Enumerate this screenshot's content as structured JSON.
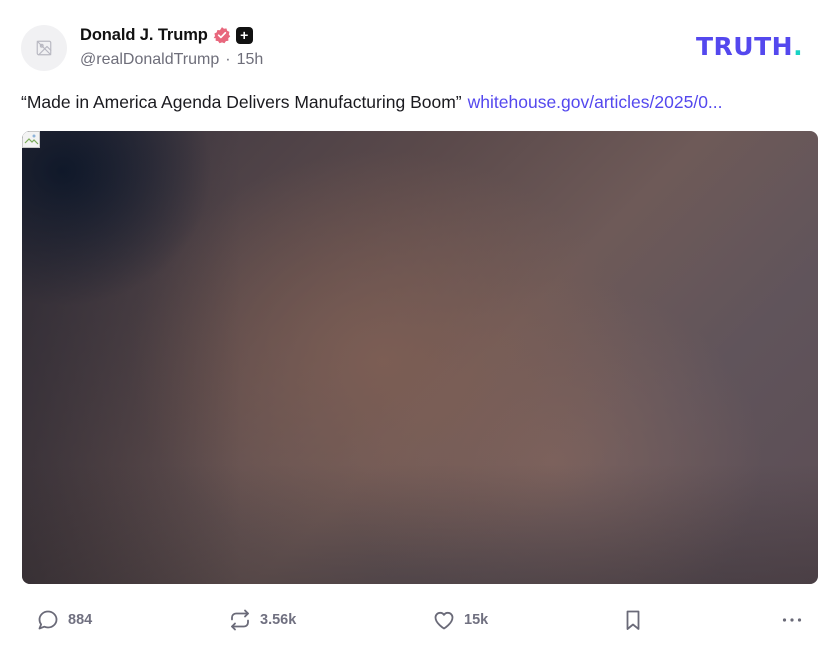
{
  "post": {
    "author": {
      "display_name": "Donald J. Trump",
      "handle": "@realDonaldTrump",
      "time_ago": "15h",
      "separator": "·",
      "verified_icon": "verified-badge-icon",
      "plus_icon": "plus-badge-icon",
      "plus_symbol": "+"
    },
    "brand": {
      "name": "TRUTH",
      "dot": ".",
      "primary_color": "#5448ee",
      "accent_color": "#17d3c4"
    },
    "text": "“Made in America Agenda Delivers Manufacturing Boom”",
    "link_text": "whitehouse.gov/articles/2025/0...",
    "link_color": "#5448ee",
    "media": {
      "icon": "broken-image-icon"
    },
    "actions": {
      "reply_count": "884",
      "retruth_count": "3.56k",
      "like_count": "15k"
    }
  }
}
